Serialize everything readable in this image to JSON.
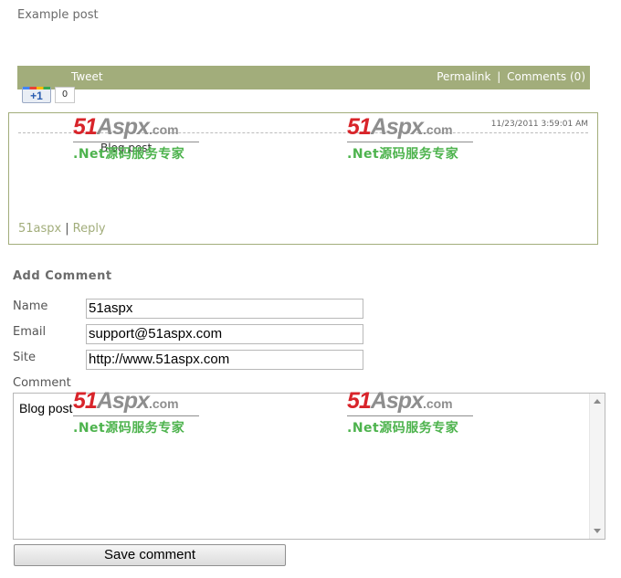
{
  "post": {
    "title": "Example post"
  },
  "share_bar": {
    "tweet_label": "Tweet",
    "permalink_label": "Permalink",
    "separator": "|",
    "comments_label": "Comments (0)",
    "gplus_label": "+1",
    "gplus_count": "0"
  },
  "comment": {
    "date": "11/23/2011 3:59:01 AM",
    "body": "Blog post",
    "author": "51aspx",
    "separator": "|",
    "reply_label": "Reply"
  },
  "form": {
    "heading": "Add Comment",
    "name_label": "Name",
    "name_value": "51aspx",
    "email_label": "Email",
    "email_value": "support@51aspx.com",
    "site_label": "Site",
    "site_value": "http://www.51aspx.com",
    "comment_label": "Comment",
    "comment_value": "Blog post",
    "save_label": "Save comment"
  },
  "watermark": {
    "brand_number": "51",
    "brand_name": "Aspx",
    "brand_domain": ".com",
    "tagline": ".Net源码服务专家"
  },
  "colors": {
    "accent": "#a2ad7b",
    "watermark_red": "#d8242a",
    "watermark_green": "#4db34d"
  }
}
